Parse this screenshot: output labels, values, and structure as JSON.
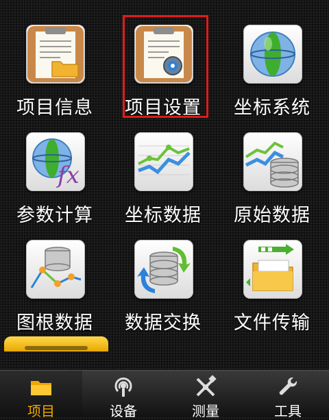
{
  "grid": {
    "items": [
      {
        "label": "项目信息",
        "icon": "clipboard-folder-icon"
      },
      {
        "label": "项目设置",
        "icon": "clipboard-gear-icon",
        "selected": true
      },
      {
        "label": "坐标系统",
        "icon": "globe-icon"
      },
      {
        "label": "参数计算",
        "icon": "globe-fx-icon"
      },
      {
        "label": "坐标数据",
        "icon": "line-chart-icon"
      },
      {
        "label": "原始数据",
        "icon": "chart-database-icon"
      },
      {
        "label": "图根数据",
        "icon": "database-network-icon"
      },
      {
        "label": "数据交换",
        "icon": "database-sync-icon"
      },
      {
        "label": "文件传输",
        "icon": "file-transfer-icon"
      }
    ]
  },
  "tabbar": {
    "tabs": [
      {
        "label": "项目",
        "icon": "folder-icon",
        "active": true
      },
      {
        "label": "设备",
        "icon": "antenna-icon"
      },
      {
        "label": "测量",
        "icon": "survey-tools-icon"
      },
      {
        "label": "工具",
        "icon": "wrench-icon"
      }
    ]
  },
  "colors": {
    "selection": "#e01b1b",
    "accent": "#f0a800",
    "background": "#161616"
  }
}
